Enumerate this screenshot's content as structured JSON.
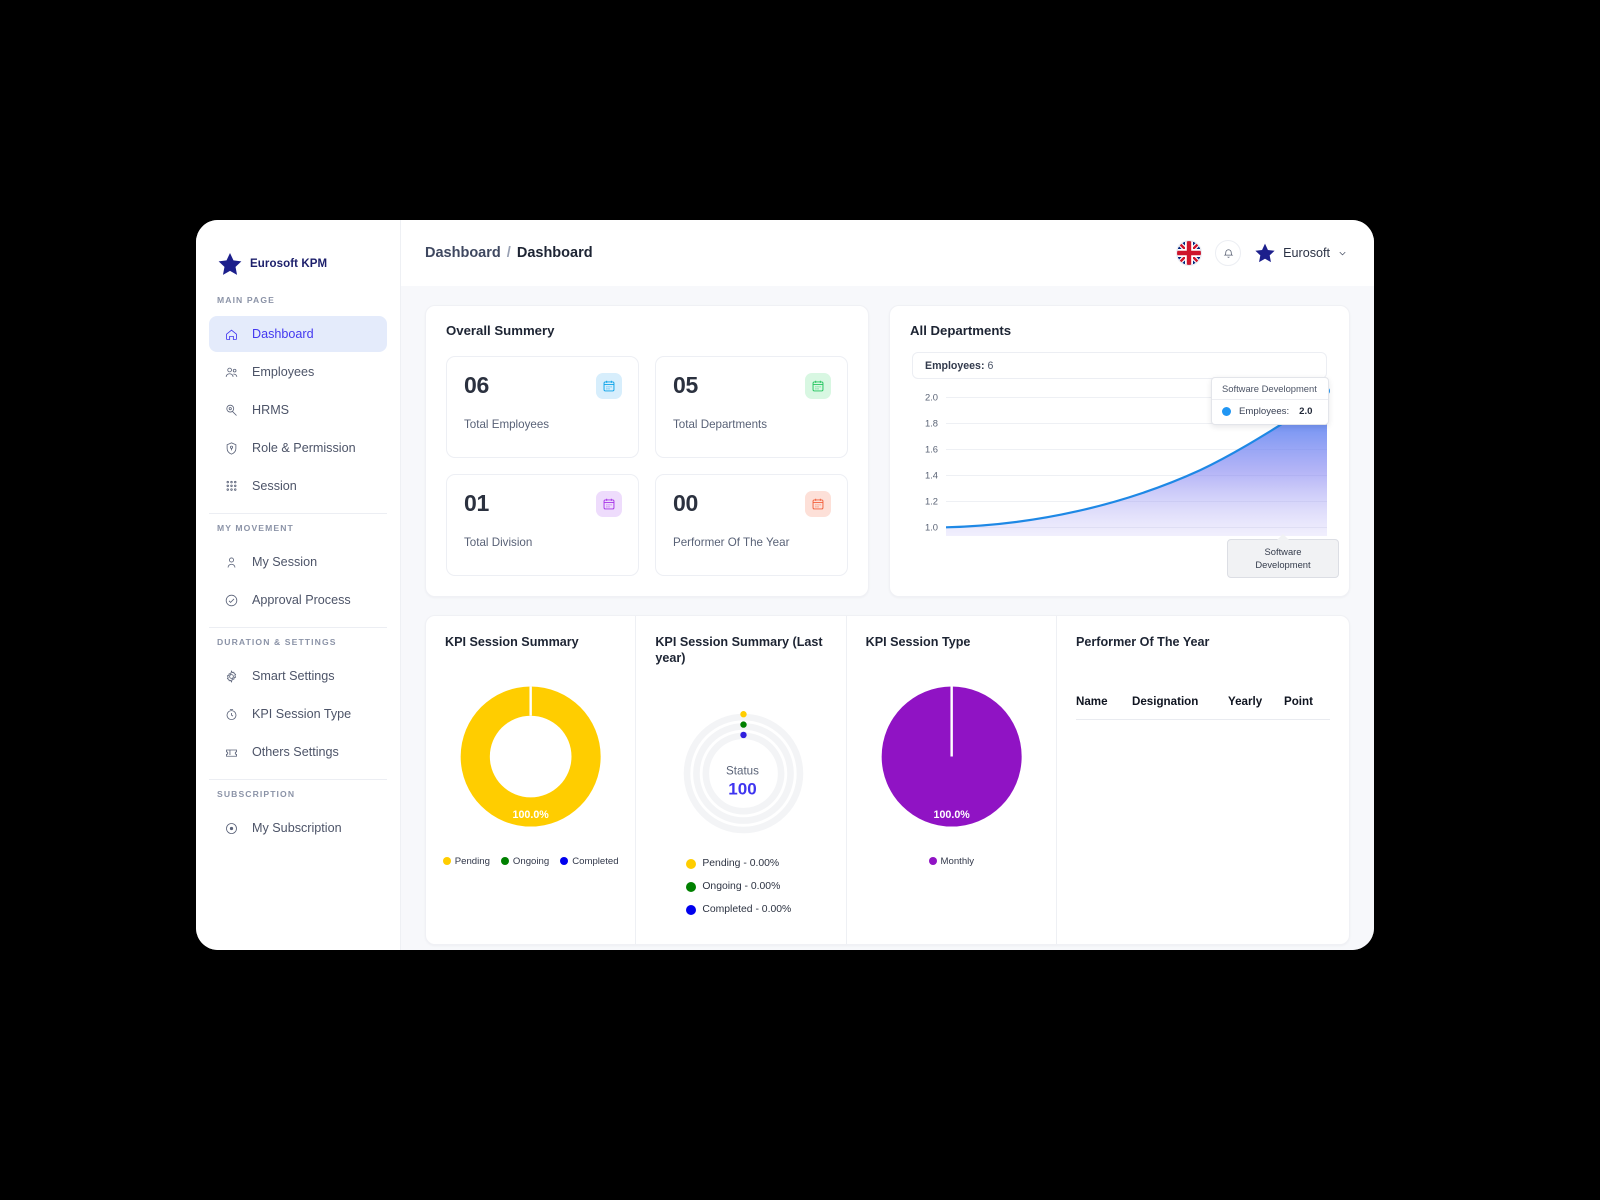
{
  "brand": {
    "name": "Eurosoft KPM",
    "logo_icon": "star-icon"
  },
  "sidebar": {
    "sections": [
      {
        "title": "MAIN PAGE",
        "items": [
          {
            "label": "Dashboard",
            "icon": "home-icon",
            "active": true
          },
          {
            "label": "Employees",
            "icon": "users-icon",
            "active": false
          },
          {
            "label": "HRMS",
            "icon": "badge-icon",
            "active": false
          },
          {
            "label": "Role & Permission",
            "icon": "shield-icon",
            "active": false
          },
          {
            "label": "Session",
            "icon": "grid-dots-icon",
            "active": false
          }
        ]
      },
      {
        "title": "MY MOVEMENT",
        "items": [
          {
            "label": "My Session",
            "icon": "user-icon",
            "active": false
          },
          {
            "label": "Approval Process",
            "icon": "check-circle-icon",
            "active": false
          }
        ]
      },
      {
        "title": "DURATION & SETTINGS",
        "items": [
          {
            "label": "Smart Settings",
            "icon": "gear-icon",
            "active": false
          },
          {
            "label": "KPI Session Type",
            "icon": "clock-icon",
            "active": false
          },
          {
            "label": "Others Settings",
            "icon": "ticket-icon",
            "active": false
          }
        ]
      },
      {
        "title": "SUBSCRIPTION",
        "items": [
          {
            "label": "My Subscription",
            "icon": "circle-dot-icon",
            "active": false
          }
        ]
      }
    ]
  },
  "topbar": {
    "breadcrumb_first": "Dashboard",
    "breadcrumb_sep": "/",
    "breadcrumb_last": "Dashboard",
    "flag_icon": "uk-flag-icon",
    "bell_icon": "bell-icon",
    "avatar_icon": "star-icon",
    "user_name": "Eurosoft",
    "caret_icon": "chevron-down-icon"
  },
  "overall_summary": {
    "title": "Overall Summery",
    "stats": [
      {
        "value": "06",
        "label": "Total Employees",
        "icon": "calendar-icon",
        "color": "#0aa2e8",
        "bg": "#d7eefc"
      },
      {
        "value": "05",
        "label": "Total Departments",
        "icon": "calendar-icon",
        "color": "#22c55e",
        "bg": "#d8f7e2"
      },
      {
        "value": "01",
        "label": "Total Division",
        "icon": "calendar-icon",
        "color": "#a633e8",
        "bg": "#eedcfc"
      },
      {
        "value": "00",
        "label": "Performer Of The Year",
        "icon": "calendar-icon",
        "color": "#f2603c",
        "bg": "#fde0d8"
      }
    ]
  },
  "all_departments": {
    "title": "All Departments",
    "legend_label": "Employees:",
    "legend_value": "6",
    "tooltip": {
      "header": "Software Development",
      "series_label": "Employees:",
      "series_value": "2.0",
      "dot_color": "#2196f3"
    },
    "x_tooltip": "Software Development"
  },
  "kpi_session_summary": {
    "title": "KPI Session Summary",
    "percent_label": "100.0%",
    "legend": [
      {
        "label": "Pending",
        "color": "#ffcd00"
      },
      {
        "label": "Ongoing",
        "color": "#008000"
      },
      {
        "label": "Completed",
        "color": "#0000ee"
      }
    ]
  },
  "kpi_session_summary_last_year": {
    "title": "KPI Session Summary (Last year)",
    "status_label": "Status",
    "status_value": "100",
    "legend": [
      {
        "label": "Pending - 0.00%",
        "color": "#ffcd00"
      },
      {
        "label": "Ongoing - 0.00%",
        "color": "#008000"
      },
      {
        "label": "Completed - 0.00%",
        "color": "#0000ee"
      }
    ]
  },
  "kpi_session_type": {
    "title": "KPI Session Type",
    "percent_label": "100.0%",
    "legend": [
      {
        "label": "Monthly",
        "color": "#9013c4"
      }
    ]
  },
  "performer_of_the_year": {
    "title": "Performer Of The Year",
    "columns": [
      "Name",
      "Designation",
      "Yearly",
      "Point"
    ],
    "rows": []
  },
  "chart_data": [
    {
      "type": "area",
      "title": "All Departments",
      "x": [
        "",
        "",
        "",
        "",
        "Software Development"
      ],
      "series": [
        {
          "name": "Employees",
          "values": [
            1.0,
            1.08,
            1.25,
            1.55,
            2.0
          ]
        }
      ],
      "ylim": [
        1.0,
        2.0
      ],
      "yticks": [
        "2.0",
        "1.8",
        "1.6",
        "1.4",
        "1.2",
        "1.0"
      ],
      "grid": true,
      "line_color": "#1e88e5",
      "legend_position": "top"
    },
    {
      "type": "pie",
      "title": "KPI Session Summary",
      "labels": [
        "Pending",
        "Ongoing",
        "Completed"
      ],
      "values": [
        100,
        0,
        0
      ],
      "data_labels": [
        "100.0%"
      ],
      "colors": [
        "#ffcd00",
        "#008000",
        "#0000ee"
      ],
      "donut": true,
      "legend_position": "bottom"
    },
    {
      "type": "pie",
      "title": "KPI Session Summary (Last year)",
      "labels": [
        "Pending - 0.00%",
        "Ongoing - 0.00%",
        "Completed - 0.00%"
      ],
      "values": [
        0,
        0,
        0
      ],
      "center_label": "Status",
      "center_value": "100",
      "colors": [
        "#ffcd00",
        "#008000",
        "#0000ee"
      ],
      "donut": true,
      "legend_position": "bottom"
    },
    {
      "type": "pie",
      "title": "KPI Session Type",
      "labels": [
        "Monthly"
      ],
      "values": [
        100
      ],
      "data_labels": [
        "100.0%"
      ],
      "colors": [
        "#9013c4"
      ],
      "donut": false,
      "legend_position": "bottom"
    }
  ]
}
